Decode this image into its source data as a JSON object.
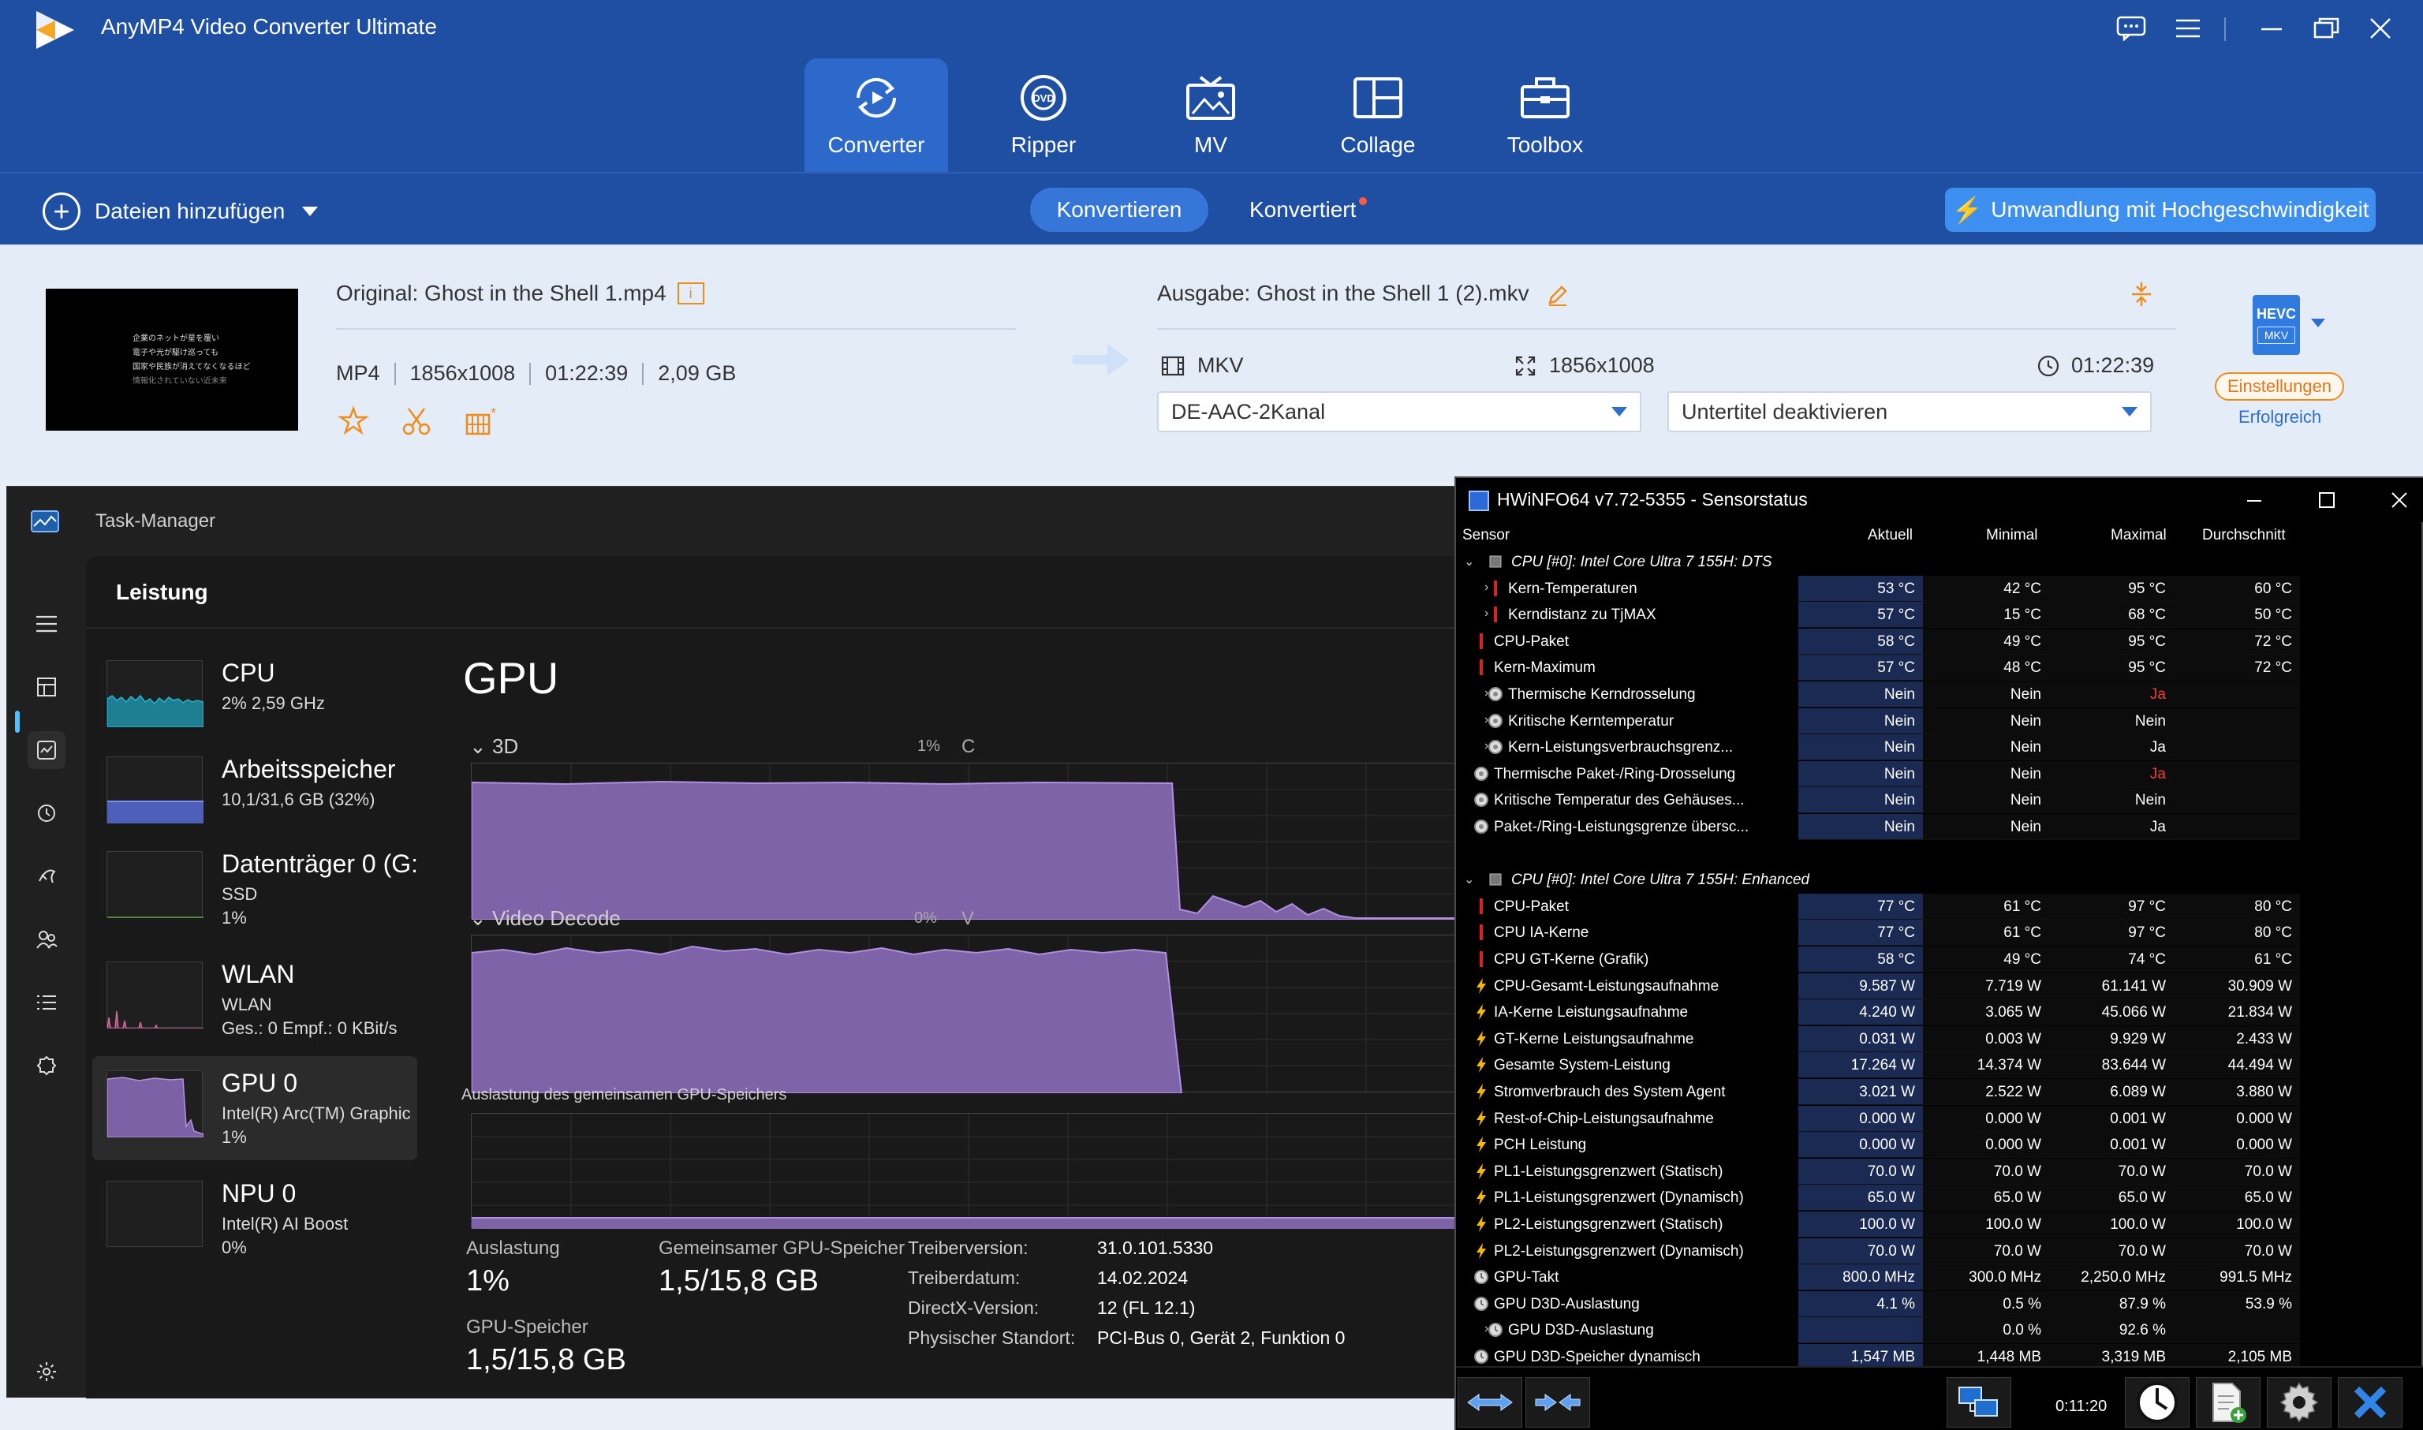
{
  "anymp4": {
    "app_title": "AnyMP4 Video Converter Ultimate",
    "nav_tabs": [
      {
        "label": "Converter",
        "icon": "converter-icon"
      },
      {
        "label": "Ripper",
        "icon": "dvd-icon"
      },
      {
        "label": "MV",
        "icon": "mv-icon"
      },
      {
        "label": "Collage",
        "icon": "collage-icon"
      },
      {
        "label": "Toolbox",
        "icon": "toolbox-icon"
      }
    ],
    "toolbar": {
      "add_files": "Dateien hinzufügen",
      "tab_convert": "Konvertieren",
      "tab_converted": "Konvertiert",
      "turbo": "Umwandlung mit Hochgeschwindigkeit"
    },
    "file": {
      "original_name": "Original: Ghost in the Shell 1.mp4",
      "format": "MP4",
      "resolution": "1856x1008",
      "duration": "01:22:39",
      "size": "2,09 GB",
      "output_name": "Ausgabe: Ghost in the Shell 1 (2).mkv",
      "out_format": "MKV",
      "out_resolution": "1856x1008",
      "out_duration": "01:22:39",
      "audio_track": "DE-AAC-2Kanal",
      "subtitle": "Untertitel deaktivieren",
      "codec_badge": "HEVC",
      "codec_sub": "MKV",
      "settings": "Einstellungen",
      "status": "Erfolgreich",
      "thumb_lines": [
        "企業のネットが星を覆い",
        "電子や光が駆け巡っても",
        "国家や民族が消えてなくなるほど",
        "情報化されていない近未来"
      ]
    },
    "colors": {
      "header": "#1f4fa3",
      "active_tab": "#2d69cb",
      "accent_orange": "#f08c1a",
      "turbo": "#3d8ff0"
    }
  },
  "taskmanager": {
    "title": "Task-Manager",
    "section": "Leistung",
    "devices": [
      {
        "name": "CPU",
        "sub1": "2% 2,59 GHz",
        "sub2": "",
        "sub3": ""
      },
      {
        "name": "Arbeitsspeicher",
        "sub1": "10,1/31,6 GB (32%)",
        "sub2": "",
        "sub3": ""
      },
      {
        "name": "Datenträger 0 (G:",
        "sub1": "SSD",
        "sub2": "1%",
        "sub3": ""
      },
      {
        "name": "WLAN",
        "sub1": "WLAN",
        "sub2": "Ges.: 0 Empf.: 0 KBit/s",
        "sub3": ""
      },
      {
        "name": "GPU 0",
        "sub1": "Intel(R) Arc(TM) Graphic",
        "sub2": "1%",
        "sub3": ""
      },
      {
        "name": "NPU 0",
        "sub1": "Intel(R) AI Boost",
        "sub2": "0%",
        "sub3": ""
      }
    ],
    "gpu": {
      "title": "GPU",
      "engine1": "3D",
      "engine1_pct": "1%",
      "engine1_cut": "C",
      "engine2": "Video Decode",
      "engine2_pct": "0%",
      "engine2_cut": "V",
      "shared_label": "Auslastung des gemeinsamen GPU-Speichers",
      "util_label": "Auslastung",
      "util_value": "1%",
      "shared_mem_label": "Gemeinsamer GPU-Speicher",
      "shared_mem_value": "1,5/15,8 GB",
      "gpu_mem_label": "GPU-Speicher",
      "gpu_mem_value": "1,5/15,8 GB",
      "driver_version_k": "Treiberversion:",
      "driver_version_v": "31.0.101.5330",
      "driver_date_k": "Treiberdatum:",
      "driver_date_v": "14.02.2024",
      "directx_k": "DirectX-Version:",
      "directx_v": "12 (FL 12.1)",
      "location_k": "Physischer Standort:",
      "location_v": "PCI-Bus 0, Gerät 2, Funktion 0"
    },
    "colors": {
      "gpu_fill": "#8f72b8",
      "cpu_fill": "#1ea2b8",
      "mem_fill": "#6c7ed6"
    }
  },
  "hwinfo": {
    "title": "HWiNFO64 v7.72-5355 - Sensorstatus",
    "headers": {
      "sensor": "Sensor",
      "current": "Aktuell",
      "min": "Minimal",
      "max": "Maximal",
      "avg": "Durchschnitt"
    },
    "rows": [
      {
        "type": "group",
        "name": "CPU [#0]: Intel Core Ultra 7 155H: DTS"
      },
      {
        "type": "row",
        "exp": true,
        "icon": "temp",
        "name": "Kern-Temperaturen",
        "v": [
          "53 °C",
          "42 °C",
          "95 °C",
          "60 °C"
        ]
      },
      {
        "type": "row",
        "exp": true,
        "icon": "temp",
        "name": "Kerndistanz zu TjMAX",
        "v": [
          "57 °C",
          "15 °C",
          "68 °C",
          "50 °C"
        ]
      },
      {
        "type": "row",
        "exp": false,
        "icon": "temp",
        "name": "CPU-Paket",
        "v": [
          "58 °C",
          "49 °C",
          "95 °C",
          "72 °C"
        ]
      },
      {
        "type": "row",
        "exp": false,
        "icon": "temp",
        "name": "Kern-Maximum",
        "v": [
          "57 °C",
          "48 °C",
          "95 °C",
          "72 °C"
        ]
      },
      {
        "type": "row",
        "exp": true,
        "icon": "bool",
        "name": "Thermische Kerndrosselung",
        "v": [
          "Nein",
          "Nein",
          "Ja",
          ""
        ],
        "red": [
          2
        ]
      },
      {
        "type": "row",
        "exp": true,
        "icon": "bool",
        "name": "Kritische Kerntemperatur",
        "v": [
          "Nein",
          "Nein",
          "Nein",
          ""
        ]
      },
      {
        "type": "row",
        "exp": true,
        "icon": "bool",
        "name": "Kern-Leistungsverbrauchsgrenz...",
        "v": [
          "Nein",
          "Nein",
          "Ja",
          ""
        ]
      },
      {
        "type": "row",
        "exp": false,
        "icon": "bool",
        "name": "Thermische Paket-/Ring-Drosselung",
        "v": [
          "Nein",
          "Nein",
          "Ja",
          ""
        ],
        "red": [
          2
        ]
      },
      {
        "type": "row",
        "exp": false,
        "icon": "bool",
        "name": "Kritische Temperatur des Gehäuses...",
        "v": [
          "Nein",
          "Nein",
          "Nein",
          ""
        ]
      },
      {
        "type": "row",
        "exp": false,
        "icon": "bool",
        "name": "Paket-/Ring-Leistungsgrenze übersc...",
        "v": [
          "Nein",
          "Nein",
          "Ja",
          ""
        ]
      },
      {
        "type": "blank"
      },
      {
        "type": "group",
        "name": "CPU [#0]: Intel Core Ultra 7 155H: Enhanced"
      },
      {
        "type": "row",
        "exp": false,
        "icon": "temp",
        "name": "CPU-Paket",
        "v": [
          "77 °C",
          "61 °C",
          "97 °C",
          "80 °C"
        ]
      },
      {
        "type": "row",
        "exp": false,
        "icon": "temp",
        "name": "CPU IA-Kerne",
        "v": [
          "77 °C",
          "61 °C",
          "97 °C",
          "80 °C"
        ]
      },
      {
        "type": "row",
        "exp": false,
        "icon": "temp",
        "name": "CPU GT-Kerne (Grafik)",
        "v": [
          "58 °C",
          "49 °C",
          "74 °C",
          "61 °C"
        ]
      },
      {
        "type": "row",
        "exp": false,
        "icon": "power",
        "name": "CPU-Gesamt-Leistungsaufnahme",
        "v": [
          "9.587 W",
          "7.719 W",
          "61.141 W",
          "30.909 W"
        ]
      },
      {
        "type": "row",
        "exp": false,
        "icon": "power",
        "name": "IA-Kerne Leistungsaufnahme",
        "v": [
          "4.240 W",
          "3.065 W",
          "45.066 W",
          "21.834 W"
        ]
      },
      {
        "type": "row",
        "exp": false,
        "icon": "power",
        "name": "GT-Kerne Leistungsaufnahme",
        "v": [
          "0.031 W",
          "0.003 W",
          "9.929 W",
          "2.433 W"
        ]
      },
      {
        "type": "row",
        "exp": false,
        "icon": "power",
        "name": "Gesamte System-Leistung",
        "v": [
          "17.264 W",
          "14.374 W",
          "83.644 W",
          "44.494 W"
        ]
      },
      {
        "type": "row",
        "exp": false,
        "icon": "power",
        "name": "Stromverbrauch des System Agent",
        "v": [
          "3.021 W",
          "2.522 W",
          "6.089 W",
          "3.880 W"
        ]
      },
      {
        "type": "row",
        "exp": false,
        "icon": "power",
        "name": "Rest-of-Chip-Leistungsaufnahme",
        "v": [
          "0.000 W",
          "0.000 W",
          "0.001 W",
          "0.000 W"
        ]
      },
      {
        "type": "row",
        "exp": false,
        "icon": "power",
        "name": "PCH Leistung",
        "v": [
          "0.000 W",
          "0.000 W",
          "0.001 W",
          "0.000 W"
        ]
      },
      {
        "type": "row",
        "exp": false,
        "icon": "power",
        "name": "PL1-Leistungsgrenzwert (Statisch)",
        "v": [
          "70.0 W",
          "70.0 W",
          "70.0 W",
          "70.0 W"
        ]
      },
      {
        "type": "row",
        "exp": false,
        "icon": "power",
        "name": "PL1-Leistungsgrenzwert (Dynamisch)",
        "v": [
          "65.0 W",
          "65.0 W",
          "65.0 W",
          "65.0 W"
        ]
      },
      {
        "type": "row",
        "exp": false,
        "icon": "power",
        "name": "PL2-Leistungsgrenzwert (Statisch)",
        "v": [
          "100.0 W",
          "100.0 W",
          "100.0 W",
          "100.0 W"
        ]
      },
      {
        "type": "row",
        "exp": false,
        "icon": "power",
        "name": "PL2-Leistungsgrenzwert (Dynamisch)",
        "v": [
          "70.0 W",
          "70.0 W",
          "70.0 W",
          "70.0 W"
        ]
      },
      {
        "type": "row",
        "exp": false,
        "icon": "clock",
        "name": "GPU-Takt",
        "v": [
          "800.0 MHz",
          "300.0 MHz",
          "2,250.0 MHz",
          "991.5 MHz"
        ]
      },
      {
        "type": "row",
        "exp": false,
        "icon": "clock",
        "name": "GPU D3D-Auslastung",
        "v": [
          "4.1 %",
          "0.5 %",
          "87.9 %",
          "53.9 %"
        ]
      },
      {
        "type": "row",
        "exp": true,
        "icon": "clock",
        "name": "GPU D3D-Auslastung",
        "v": [
          "",
          "0.0 %",
          "92.6 %",
          ""
        ]
      },
      {
        "type": "row",
        "exp": false,
        "icon": "clock",
        "name": "GPU D3D-Speicher dynamisch",
        "v": [
          "1,547 MB",
          "1,448 MB",
          "3,319 MB",
          "2,105 MB"
        ]
      }
    ],
    "timer": "0:11:20",
    "colors": {
      "current_col": "#1a2a52",
      "alert": "#ff3b30",
      "power_icon": "#f5b800"
    }
  }
}
